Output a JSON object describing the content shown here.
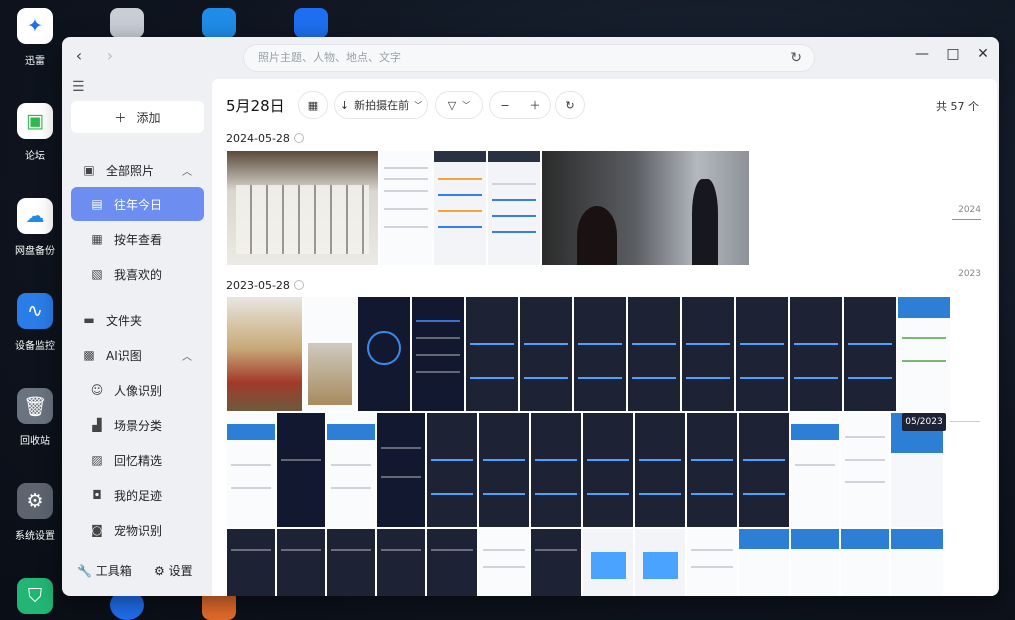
{
  "desktop": {
    "icons": [
      {
        "label": "迅雷",
        "icon": "xunlei-bird-icon",
        "color": "#1e6ff0"
      },
      {
        "label": "论坛",
        "icon": "chat-bubble-icon",
        "color": "#2fb84f"
      },
      {
        "label": "网盘备份",
        "icon": "cloud-upload-icon",
        "color": "#1f8de8"
      },
      {
        "label": "设备监控",
        "icon": "waveform-icon",
        "color": "#2a7ce6"
      },
      {
        "label": "回收站",
        "icon": "trash-icon",
        "color": "#6b7280"
      },
      {
        "label": "系统设置",
        "icon": "gear-icon",
        "color": "#5d6470"
      }
    ]
  },
  "window": {
    "search": {
      "placeholder": "照片主题、人物、地点、文字"
    },
    "controls": {
      "minimize": "—",
      "maximize": "□",
      "close": "✕"
    }
  },
  "sidebar": {
    "add_label": "添加",
    "items": [
      {
        "label": "全部照片",
        "icon": "photos-icon",
        "type": "section",
        "expanded": true
      },
      {
        "label": "往年今日",
        "icon": "calendar-image-icon",
        "type": "sub",
        "active": true
      },
      {
        "label": "按年查看",
        "icon": "calendar-grid-icon",
        "type": "sub"
      },
      {
        "label": "我喜欢的",
        "icon": "heart-image-icon",
        "type": "sub"
      },
      {
        "label": "文件夹",
        "icon": "folder-icon",
        "type": "section"
      },
      {
        "label": "AI识图",
        "icon": "ai-image-icon",
        "type": "section",
        "expanded": true
      },
      {
        "label": "人像识别",
        "icon": "face-icon",
        "type": "sub"
      },
      {
        "label": "场景分类",
        "icon": "scene-icon",
        "type": "sub"
      },
      {
        "label": "回忆精选",
        "icon": "memory-icon",
        "type": "sub"
      },
      {
        "label": "我的足迹",
        "icon": "footprint-icon",
        "type": "sub"
      },
      {
        "label": "宠物识别",
        "icon": "pet-icon",
        "type": "sub"
      }
    ],
    "toolbox_label": "工具箱",
    "settings_label": "设置"
  },
  "main": {
    "date_title": "5月28日",
    "sort_label": "新拍摄在前",
    "total_label": "共 57 个",
    "groups": [
      {
        "date": "2024-05-28"
      },
      {
        "date": "2023-05-28"
      }
    ],
    "timeline": {
      "years": [
        "2024",
        "2023"
      ],
      "tooltip": "05/2023"
    }
  }
}
